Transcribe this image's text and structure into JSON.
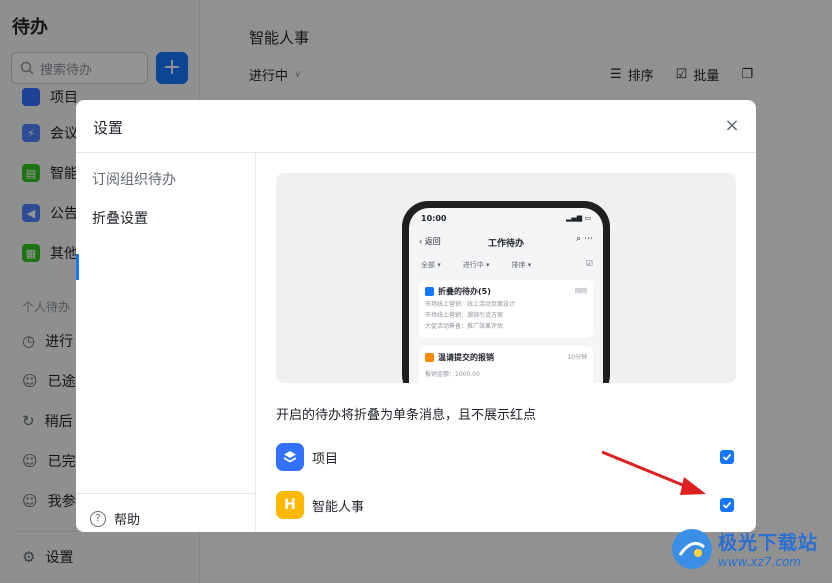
{
  "sidebar": {
    "title": "待办",
    "search_placeholder": "搜索待办",
    "add_label": "+",
    "items": [
      {
        "label": "项目"
      },
      {
        "label": "会议"
      },
      {
        "label": "智能"
      },
      {
        "label": "公告"
      },
      {
        "label": "其他"
      }
    ],
    "section_label": "个人待办",
    "personal_items": [
      {
        "label": "进行"
      },
      {
        "label": "已途"
      },
      {
        "label": "稍后"
      },
      {
        "label": "已完"
      },
      {
        "label": "我参"
      }
    ],
    "settings_label": "设置"
  },
  "main": {
    "title": "智能人事",
    "filter_label": "进行中",
    "sort_label": "排序",
    "batch_label": "批量"
  },
  "dialog": {
    "title": "设置",
    "close_label": "×",
    "nav": [
      {
        "label": "订阅组织待办"
      },
      {
        "label": "折叠设置"
      }
    ],
    "help_label": "帮助",
    "description": "开启的待办将折叠为单条消息，且不展示红点",
    "options": [
      {
        "label": "项目",
        "checked": true,
        "icon": "project-icon",
        "color": "#3370ff"
      },
      {
        "label": "智能人事",
        "checked": true,
        "icon": "hr-icon",
        "color": "#ffb800"
      }
    ]
  },
  "preview": {
    "status_time": "10:00",
    "back_label": "返回",
    "title": "工作待办",
    "filters": [
      "全部",
      "进行中",
      "排序"
    ],
    "card1": {
      "title": "折叠的待办(5)",
      "right": "刚刚",
      "rows": [
        "市场线上营销：线上活动页面设计",
        "市场线上营销：潮锦引流方案",
        "大促活动筹备：推广效果评估"
      ]
    },
    "card2": {
      "title": "温请提交的报销",
      "right": "10分钟",
      "row": "报销金额：1000.00"
    }
  },
  "watermark": {
    "name": "极光下载站",
    "url": "www.xz7.com"
  },
  "colors": {
    "accent": "#1677ff",
    "arrow": "#e02020"
  }
}
